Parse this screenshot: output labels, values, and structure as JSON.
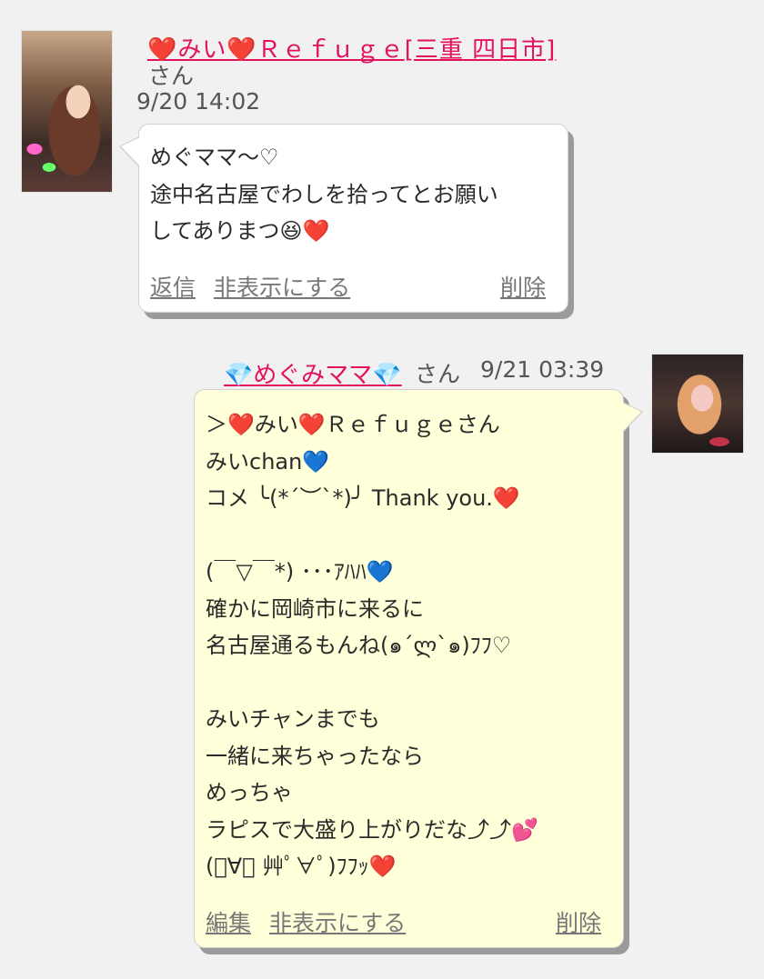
{
  "message1": {
    "sender": "❤️みい❤️Ｒｅｆｕｇｅ[三重 四日市]",
    "honorific": "さん",
    "timestamp": "9/20 14:02",
    "body": "めぐママ〜♡\n途中名古屋でわしを拾ってとお願い\nしてありまつ😆❤️",
    "actions": {
      "reply": "返信",
      "hide": "非表示にする",
      "delete": "削除"
    }
  },
  "message2": {
    "sender": "💎めぐみママ💎",
    "honorific": "さん",
    "timestamp": "9/21 03:39",
    "body": "＞❤️みい❤️Ｒｅｆｕｇｅさん\nみいchan💙\nコメ ╰(*´︶`*)╯ Thank you.❤️\n\n(￣▽￣*) ･･･ｱﾊﾊ💙\n確かに岡崎市に来るに\n名古屋通るもんね(๑´ლ`๑)ﾌﾌ♡\n\nみいチャンまでも\n一緒に来ちゃったなら\nめっちゃ\nラピスで大盛り上がりだな⤴︎⤴︎💕\n(ﾟ∀ﾟ 艸ﾟ∀ﾟ)ﾌﾌｯ❤️",
    "actions": {
      "edit": "編集",
      "hide": "非表示にする",
      "delete": "削除"
    }
  },
  "colors": {
    "background": "#f1f1f1",
    "name_link": "#e3115e",
    "own_bubble": "#ffffd9",
    "other_bubble": "#ffffff"
  }
}
